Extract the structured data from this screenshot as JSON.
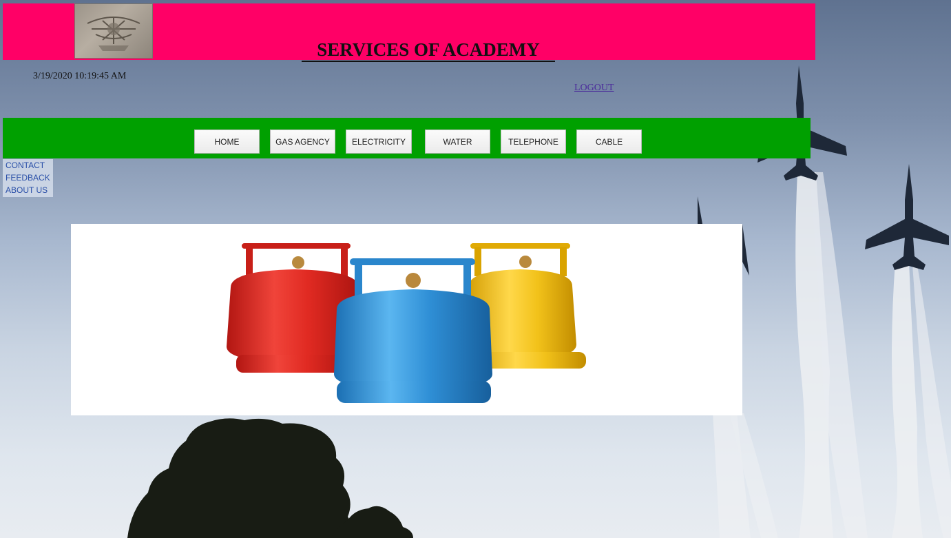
{
  "header": {
    "title": "SERVICES OF ACADEMY",
    "background_color": "#ff0066"
  },
  "status": {
    "datetime": "3/19/2020 10:19:45 AM"
  },
  "account": {
    "logout_label": "LOGOUT"
  },
  "nav": {
    "background_color": "#00a000",
    "items": [
      {
        "label": "HOME"
      },
      {
        "label": "GAS AGENCY"
      },
      {
        "label": "ELECTRICITY"
      },
      {
        "label": "WATER"
      },
      {
        "label": "TELEPHONE"
      },
      {
        "label": "CABLE"
      }
    ]
  },
  "sidebar": {
    "items": [
      {
        "label": "CONTACT"
      },
      {
        "label": "FEEDBACK"
      },
      {
        "label": "ABOUT US"
      }
    ]
  },
  "banner": {
    "image": "gas-cylinders-icon",
    "cylinder_colors": [
      "#e02a22",
      "#2f8fd6",
      "#f2c21a"
    ]
  }
}
